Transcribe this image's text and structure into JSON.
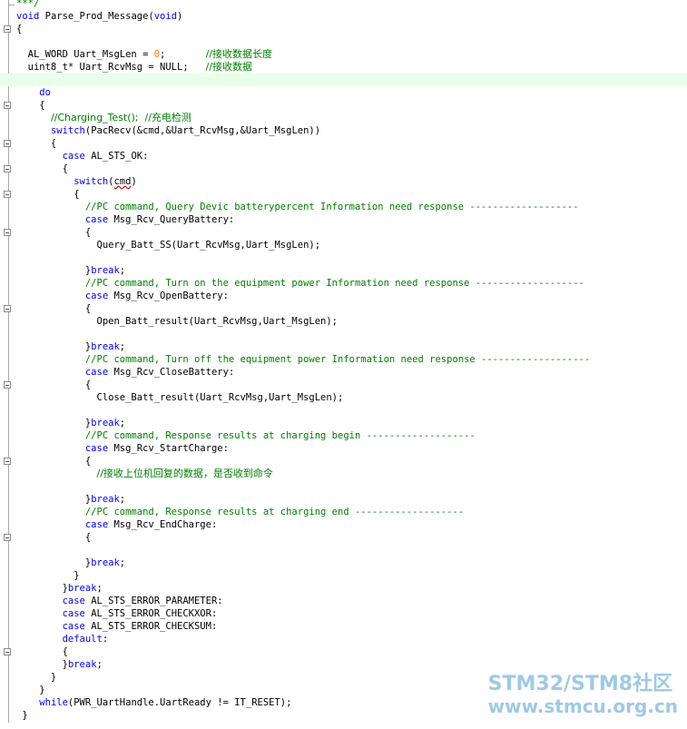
{
  "lines": [
    {
      "parts": [
        {
          "t": "***/",
          "c": "cmt"
        }
      ],
      "end": true
    },
    {
      "parts": [
        {
          "t": "void",
          "c": "kw"
        },
        {
          "t": " Parse_Prod_Message("
        },
        {
          "t": "void",
          "c": "kw"
        },
        {
          "t": ")"
        }
      ]
    },
    {
      "parts": [
        {
          "t": "{"
        }
      ],
      "fold": true
    },
    {
      "parts": []
    },
    {
      "parts": [
        {
          "t": "  AL_WORD Uart_MsgLen = "
        },
        {
          "t": "0",
          "c": "num"
        },
        {
          "t": ";       "
        },
        {
          "t": "//接收数据长度",
          "c": "cmt cn"
        }
      ]
    },
    {
      "parts": [
        {
          "t": "  uint8_t* Uart_RcvMsg = NULL;   "
        },
        {
          "t": "//接收数据",
          "c": "cmt cn"
        }
      ]
    },
    {
      "parts": [],
      "highlight": true
    },
    {
      "parts": [
        {
          "t": "    "
        },
        {
          "t": "do",
          "c": "kw"
        }
      ]
    },
    {
      "parts": [
        {
          "t": "    {"
        }
      ],
      "fold": true
    },
    {
      "parts": [
        {
          "t": "      "
        },
        {
          "t": "//Charging_Test();  //充电检测",
          "c": "cmt cn"
        }
      ]
    },
    {
      "parts": [
        {
          "t": "      "
        },
        {
          "t": "switch",
          "c": "kw"
        },
        {
          "t": "(PacRecv(&cmd,&Uart_RcvMsg,&Uart_MsgLen))"
        }
      ]
    },
    {
      "parts": [
        {
          "t": "      {"
        }
      ],
      "fold": true
    },
    {
      "parts": [
        {
          "t": "        "
        },
        {
          "t": "case",
          "c": "kw"
        },
        {
          "t": " AL_STS_OK:"
        }
      ]
    },
    {
      "parts": [
        {
          "t": "        {"
        }
      ],
      "fold": true
    },
    {
      "parts": [
        {
          "t": "          "
        },
        {
          "t": "switch",
          "c": "kw"
        },
        {
          "t": "("
        },
        {
          "t": "cmd",
          "c": "squiggle"
        },
        {
          "t": ")"
        }
      ]
    },
    {
      "parts": [
        {
          "t": "          {"
        }
      ],
      "fold": true
    },
    {
      "parts": [
        {
          "t": "            "
        },
        {
          "t": "//PC command, Query Devic batterypercent Information need response -------------------",
          "c": "cmt"
        }
      ]
    },
    {
      "parts": [
        {
          "t": "            "
        },
        {
          "t": "case",
          "c": "kw"
        },
        {
          "t": " Msg_Rcv_QueryBattery:"
        }
      ]
    },
    {
      "parts": [
        {
          "t": "            {"
        }
      ],
      "fold": true
    },
    {
      "parts": [
        {
          "t": "              Query_Batt_SS(Uart_RcvMsg,Uart_MsgLen);"
        }
      ]
    },
    {
      "parts": []
    },
    {
      "parts": [
        {
          "t": "            }"
        },
        {
          "t": "break",
          "c": "kw"
        },
        {
          "t": ";"
        }
      ]
    },
    {
      "parts": [
        {
          "t": "            "
        },
        {
          "t": "//PC command, Turn on the equipment power Information need response -------------------",
          "c": "cmt"
        }
      ]
    },
    {
      "parts": [
        {
          "t": "            "
        },
        {
          "t": "case",
          "c": "kw"
        },
        {
          "t": " Msg_Rcv_OpenBattery:"
        }
      ]
    },
    {
      "parts": [
        {
          "t": "            {"
        }
      ],
      "fold": true
    },
    {
      "parts": [
        {
          "t": "              Open_Batt_result(Uart_RcvMsg,Uart_MsgLen);"
        }
      ]
    },
    {
      "parts": []
    },
    {
      "parts": [
        {
          "t": "            }"
        },
        {
          "t": "break",
          "c": "kw"
        },
        {
          "t": ";"
        }
      ]
    },
    {
      "parts": [
        {
          "t": "            "
        },
        {
          "t": "//PC command, Turn off the equipment power Information need response -------------------",
          "c": "cmt"
        }
      ]
    },
    {
      "parts": [
        {
          "t": "            "
        },
        {
          "t": "case",
          "c": "kw"
        },
        {
          "t": " Msg_Rcv_CloseBattery:"
        }
      ]
    },
    {
      "parts": [
        {
          "t": "            {"
        }
      ],
      "fold": true
    },
    {
      "parts": [
        {
          "t": "              Close_Batt_result(Uart_RcvMsg,Uart_MsgLen);"
        }
      ]
    },
    {
      "parts": []
    },
    {
      "parts": [
        {
          "t": "            }"
        },
        {
          "t": "break",
          "c": "kw"
        },
        {
          "t": ";"
        }
      ]
    },
    {
      "parts": [
        {
          "t": "            "
        },
        {
          "t": "//PC command, Response results at charging begin -------------------",
          "c": "cmt"
        }
      ]
    },
    {
      "parts": [
        {
          "t": "            "
        },
        {
          "t": "case",
          "c": "kw"
        },
        {
          "t": " Msg_Rcv_StartCharge:"
        }
      ]
    },
    {
      "parts": [
        {
          "t": "            {"
        }
      ],
      "fold": true
    },
    {
      "parts": [
        {
          "t": "              "
        },
        {
          "t": "//接收上位机回复的数据，是否收到命令",
          "c": "cmt cn"
        }
      ]
    },
    {
      "parts": []
    },
    {
      "parts": [
        {
          "t": "            }"
        },
        {
          "t": "break",
          "c": "kw"
        },
        {
          "t": ";"
        }
      ]
    },
    {
      "parts": [
        {
          "t": "            "
        },
        {
          "t": "//PC command, Response results at charging end -------------------",
          "c": "cmt"
        }
      ]
    },
    {
      "parts": [
        {
          "t": "            "
        },
        {
          "t": "case",
          "c": "kw"
        },
        {
          "t": " Msg_Rcv_EndCharge:"
        }
      ]
    },
    {
      "parts": [
        {
          "t": "            {"
        }
      ],
      "fold": true
    },
    {
      "parts": []
    },
    {
      "parts": [
        {
          "t": "            }"
        },
        {
          "t": "break",
          "c": "kw"
        },
        {
          "t": ";"
        }
      ]
    },
    {
      "parts": [
        {
          "t": "          }"
        }
      ]
    },
    {
      "parts": [
        {
          "t": "        }"
        },
        {
          "t": "break",
          "c": "kw"
        },
        {
          "t": ";"
        }
      ]
    },
    {
      "parts": [
        {
          "t": "        "
        },
        {
          "t": "case",
          "c": "kw"
        },
        {
          "t": " AL_STS_ERROR_PARAMETER:"
        }
      ]
    },
    {
      "parts": [
        {
          "t": "        "
        },
        {
          "t": "case",
          "c": "kw"
        },
        {
          "t": " AL_STS_ERROR_CHECKXOR:"
        }
      ]
    },
    {
      "parts": [
        {
          "t": "        "
        },
        {
          "t": "case",
          "c": "kw"
        },
        {
          "t": " AL_STS_ERROR_CHECKSUM:"
        }
      ]
    },
    {
      "parts": [
        {
          "t": "        "
        },
        {
          "t": "default",
          "c": "kw"
        },
        {
          "t": ":"
        }
      ]
    },
    {
      "parts": [
        {
          "t": "        {"
        }
      ],
      "fold": true
    },
    {
      "parts": [
        {
          "t": "        }"
        },
        {
          "t": "break",
          "c": "kw"
        },
        {
          "t": ";"
        }
      ]
    },
    {
      "parts": [
        {
          "t": "      }"
        }
      ]
    },
    {
      "parts": [
        {
          "t": "    }"
        }
      ]
    },
    {
      "parts": [
        {
          "t": "    "
        },
        {
          "t": "while",
          "c": "kw"
        },
        {
          "t": "(PWR_UartHandle.UartReady != IT_RESET);"
        }
      ]
    },
    {
      "parts": [
        {
          "t": " }"
        }
      ]
    }
  ],
  "watermark": {
    "title": "STM32/STM8社区",
    "url": "www.stmcu.org.cn"
  },
  "colors": {
    "keyword": "#0000ff",
    "comment": "#008000",
    "number": "#ff8000",
    "highlight": "#e8ffe8",
    "watermark": "#9ec9e6"
  }
}
